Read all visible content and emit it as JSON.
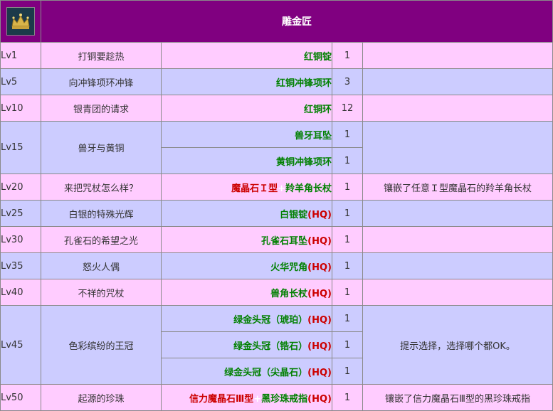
{
  "header": {
    "icon": "crown-icon",
    "title": "雕金匠"
  },
  "colors": {
    "header_bg": "#800080",
    "row_pink": "#ffccff",
    "row_blue": "#ccccff",
    "item_green": "#008000",
    "hq_red": "#cc0000"
  },
  "rows": [
    {
      "level": "Lv1",
      "quest": "打铜要趁热",
      "items": [
        {
          "parts": [
            {
              "t": "红铜锭",
              "c": "green"
            }
          ],
          "qty": "1"
        }
      ],
      "note": ""
    },
    {
      "level": "Lv5",
      "quest": "向冲锋项环冲锋",
      "items": [
        {
          "parts": [
            {
              "t": "红铜冲锋项环",
              "c": "green"
            }
          ],
          "qty": "3"
        }
      ],
      "note": ""
    },
    {
      "level": "Lv10",
      "quest": "银青团的请求",
      "items": [
        {
          "parts": [
            {
              "t": "红铜环",
              "c": "green"
            }
          ],
          "qty": "12"
        }
      ],
      "note": ""
    },
    {
      "level": "Lv15",
      "quest": "兽牙与黄铜",
      "items": [
        {
          "parts": [
            {
              "t": "兽牙耳坠",
              "c": "green"
            }
          ],
          "qty": "1"
        },
        {
          "parts": [
            {
              "t": "黄铜冲锋项环",
              "c": "green"
            }
          ],
          "qty": "1"
        }
      ],
      "note": ""
    },
    {
      "level": "Lv20",
      "quest": "来把咒杖怎么样？",
      "items": [
        {
          "parts": [
            {
              "t": "魔晶石Ｉ型",
              "c": "red"
            },
            {
              "t": "+",
              "c": "plus"
            },
            {
              "t": "羚羊角长杖",
              "c": "green"
            }
          ],
          "qty": "1"
        }
      ],
      "note": "镶嵌了任意Ｉ型魔晶石的羚羊角长杖"
    },
    {
      "level": "Lv25",
      "quest": "白银的特殊光辉",
      "items": [
        {
          "parts": [
            {
              "t": "白银锭",
              "c": "green"
            },
            {
              "t": "(HQ)",
              "c": "red"
            }
          ],
          "qty": "1"
        }
      ],
      "note": ""
    },
    {
      "level": "Lv30",
      "quest": "孔雀石的希望之光",
      "items": [
        {
          "parts": [
            {
              "t": "孔雀石耳坠",
              "c": "green"
            },
            {
              "t": "(HQ)",
              "c": "red"
            }
          ],
          "qty": "1"
        }
      ],
      "note": ""
    },
    {
      "level": "Lv35",
      "quest": "怒火人偶",
      "items": [
        {
          "parts": [
            {
              "t": "火华咒角",
              "c": "green"
            },
            {
              "t": "(HQ)",
              "c": "red"
            }
          ],
          "qty": "1"
        }
      ],
      "note": ""
    },
    {
      "level": "Lv40",
      "quest": "不祥的咒杖",
      "items": [
        {
          "parts": [
            {
              "t": "兽角长杖",
              "c": "green"
            },
            {
              "t": "(HQ)",
              "c": "red"
            }
          ],
          "qty": "1"
        }
      ],
      "note": ""
    },
    {
      "level": "Lv45",
      "quest": "色彩缤纷的王冠",
      "items": [
        {
          "parts": [
            {
              "t": "绿金头冠（琥珀）",
              "c": "green"
            },
            {
              "t": "(HQ)",
              "c": "red"
            }
          ],
          "qty": "1"
        },
        {
          "parts": [
            {
              "t": "绿金头冠（锆石）",
              "c": "green"
            },
            {
              "t": "(HQ)",
              "c": "red"
            }
          ],
          "qty": "1"
        },
        {
          "parts": [
            {
              "t": "绿金头冠（尖晶石）",
              "c": "green"
            },
            {
              "t": "(HQ)",
              "c": "red"
            }
          ],
          "qty": "1"
        }
      ],
      "note": "提示选择，选择哪个都OK。"
    },
    {
      "level": "Lv50",
      "quest": "起源的珍珠",
      "items": [
        {
          "parts": [
            {
              "t": "信力魔晶石Ⅲ型",
              "c": "red"
            },
            {
              "t": "+",
              "c": "plus"
            },
            {
              "t": "黑珍珠戒指",
              "c": "green"
            },
            {
              "t": "(HQ)",
              "c": "red"
            }
          ],
          "qty": "1"
        }
      ],
      "note": "镶嵌了信力魔晶石Ⅲ型的黑珍珠戒指"
    }
  ]
}
